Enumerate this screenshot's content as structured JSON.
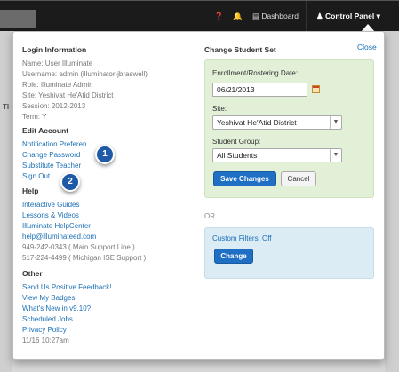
{
  "topbar": {
    "help_icon": "question-circle-icon",
    "bell_icon": "bell-icon",
    "dashboard_icon": "bar-chart-icon",
    "dashboard_label": "Dashboard",
    "user_icon": "user-icon",
    "control_panel_label": "Control Panel",
    "caret_icon": "caret-down-icon"
  },
  "background": {
    "partial_text": "TI"
  },
  "login": {
    "heading": "Login Information",
    "name": "Name: User Illuminate",
    "username": "Username: admin (illuminator-jbraswell)",
    "role": "Role: Illuminate Admin",
    "site": "Site: Yeshivat He'Atid District",
    "session": "Session: 2012-2013",
    "term": "Term: Y"
  },
  "edit_account": {
    "heading": "Edit Account",
    "items": [
      "Notification Preferen",
      "Change Password",
      "Substitute Teacher",
      "Sign Out"
    ]
  },
  "help": {
    "heading": "Help",
    "items": [
      "Interactive Guides",
      "Lessons & Videos",
      "Illuminate HelpCenter",
      "help@illuminateed.com"
    ],
    "phone1": "949-242-0343 ( Main Support Line )",
    "phone2": "517-224-4499 ( Michigan ISE Support )"
  },
  "other": {
    "heading": "Other",
    "items": [
      "Send Us Positive Feedback!",
      "View My Badges",
      "What's New in v9.10?",
      "Scheduled Jobs",
      "Privacy Policy"
    ],
    "timestamp": "11/16 10:27am"
  },
  "student_set": {
    "heading": "Change Student Set",
    "close_label": "Close",
    "date_label": "Enrollment/Rostering Date:",
    "date_value": "06/21/2013",
    "calendar_icon": "calendar-icon",
    "site_label": "Site:",
    "site_value": "Yeshivat He'Atid District",
    "group_label": "Student Group:",
    "group_value": "All Students",
    "save_label": "Save Changes",
    "cancel_label": "Cancel",
    "or_label": "OR",
    "custom_filters": "Custom Filters: Off",
    "change_label": "Change"
  },
  "callouts": [
    "1",
    "2"
  ]
}
